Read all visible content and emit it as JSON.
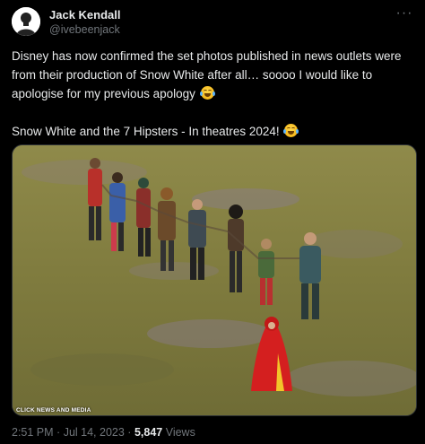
{
  "author": {
    "display_name": "Jack Kendall",
    "handle": "@ivebeenjack"
  },
  "tweet": {
    "paragraph_1": "Disney has now confirmed the set photos published in news outlets were from their production of Snow White after all… soooo I would like to apologise for my previous apology",
    "paragraph_2": "Snow White and the 7 Hipsters - In theatres 2024!",
    "emoji": "face-with-tears-of-joy",
    "more_label": "···"
  },
  "media": {
    "watermark": "CLICK NEWS AND MEDIA",
    "colors": {
      "grass": "#7d7a3c",
      "red_cloak": "#d41f1f",
      "heather": "#8a7d8e"
    }
  },
  "meta": {
    "time": "2:51 PM",
    "separator": "·",
    "date": "Jul 14, 2023",
    "views_count": "5,847",
    "views_label": "Views"
  },
  "colors": {
    "background": "#000000",
    "text": "#e7e9ea",
    "secondary": "#71767b"
  }
}
